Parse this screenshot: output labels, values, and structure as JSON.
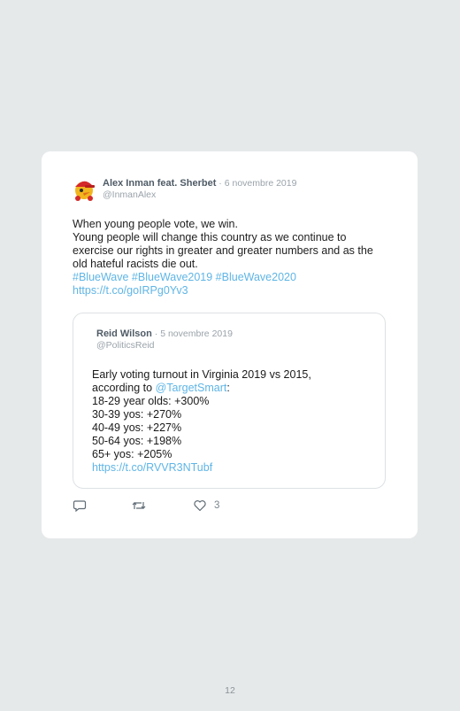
{
  "tweet": {
    "display_name": "Alex Inman feat. Sherbet",
    "separator": " · ",
    "date": "6 novembre 2019",
    "handle": "@InmanAlex",
    "lines": [
      "When young people vote, we win.",
      "Young people will change this country as we continue to exercise our rights in greater and greater numbers and as the old hateful racists die out."
    ],
    "hashtags": "#BlueWave #BlueWave2019 #BlueWave2020",
    "link": "https://t.co/goIRPg0Yv3"
  },
  "quoted": {
    "display_name": "Reid Wilson",
    "separator": " · ",
    "date": "5 novembre 2019",
    "handle": "@PoliticsReid",
    "line1": "Early voting turnout in Virginia 2019 vs 2015,",
    "line2_prefix": "according to ",
    "mention": "@TargetSmart",
    "line2_suffix": ":",
    "stats": [
      "18-29 year olds: +300%",
      "30-39 yos: +270%",
      "40-49 yos: +227%",
      "50-64 yos: +198%",
      "65+ yos: +205%"
    ],
    "link": "https://t.co/RVVR3NTubf"
  },
  "actions": {
    "reply_icon": "reply-icon",
    "retweet_icon": "retweet-icon",
    "like_icon": "heart-icon",
    "like_count": "3"
  },
  "page": {
    "number": "12"
  },
  "colors": {
    "link": "#5fb5e6",
    "background": "#e6e9ea",
    "card": "#ffffff"
  }
}
